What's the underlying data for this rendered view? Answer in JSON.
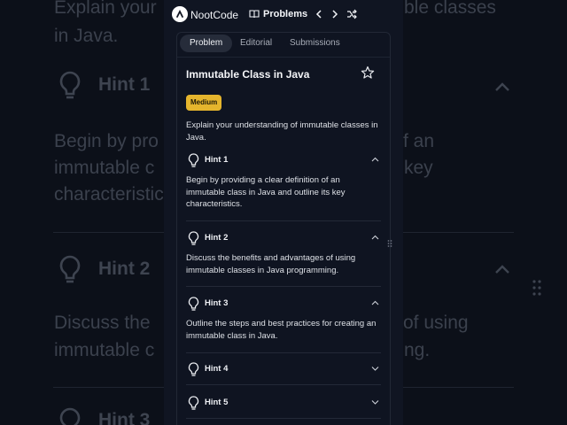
{
  "app": {
    "brand": "NootCode",
    "problems_label": "Problems"
  },
  "tabs": [
    {
      "label": "Problem",
      "active": true
    },
    {
      "label": "Editorial",
      "active": false
    },
    {
      "label": "Submissions",
      "active": false
    }
  ],
  "problem": {
    "title": "Immutable Class in Java",
    "difficulty": "Medium",
    "description": "Explain your understanding of immutable classes in Java."
  },
  "hints": [
    {
      "label": "Hint 1",
      "expanded": true,
      "text": "Begin by providing a clear definition of an immutable class in Java and outline its key characteristics."
    },
    {
      "label": "Hint 2",
      "expanded": true,
      "text": "Discuss the benefits and advantages of using immutable classes in Java programming."
    },
    {
      "label": "Hint 3",
      "expanded": true,
      "text": "Outline the steps and best practices for creating an immutable class in Java."
    },
    {
      "label": "Hint 4",
      "expanded": false,
      "text": ""
    },
    {
      "label": "Hint 5",
      "expanded": false,
      "text": ""
    }
  ],
  "background": {
    "line1": "Explain your",
    "line1b": "ble classes",
    "line2": "in Java.",
    "hint1": "Hint 1",
    "p1a": "Begin by pro",
    "p1a_end": "f an",
    "p1b": "immutable c",
    "p1b_end": "key",
    "p1c": "characteristic",
    "hint2": "Hint 2",
    "p2a": "Discuss the",
    "p2a_end": "of using",
    "p2b": "immutable c",
    "p2b_end": "ng.",
    "hint3": "Hint 3"
  },
  "colors": {
    "background": "#0c1019",
    "panel": "#101522",
    "badge": "#e5b52d",
    "tab_active": "#262c3a"
  }
}
